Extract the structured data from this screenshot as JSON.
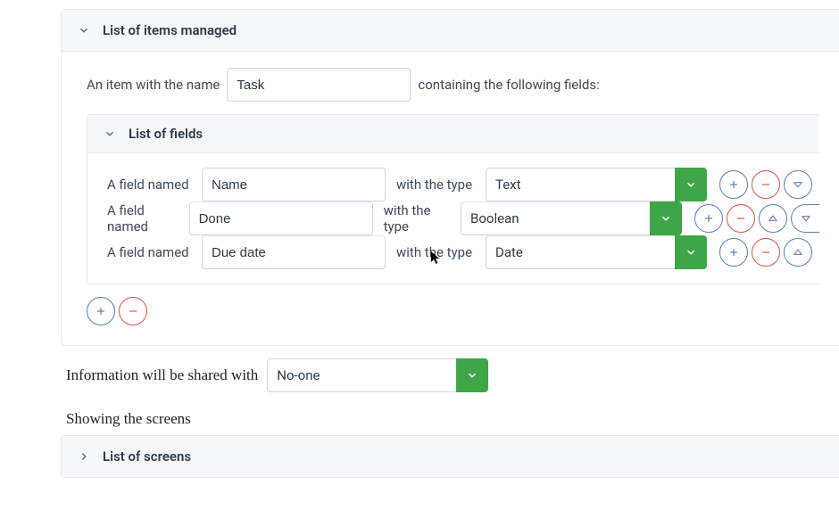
{
  "items_panel": {
    "title": "List of items managed",
    "item_prefix": "An item with the name",
    "item_name_value": "Task",
    "item_suffix": "containing the following fields:",
    "fields_panel_title": "List of fields",
    "field_prefix": "A field named",
    "field_type_prefix": "with the type",
    "fields": [
      {
        "name": "Name",
        "type": "Text"
      },
      {
        "name": "Done",
        "type": "Boolean"
      },
      {
        "name": "Due date",
        "type": "Date"
      }
    ]
  },
  "share": {
    "prefix": "Information will be shared   with",
    "value": "No-one"
  },
  "screens": {
    "heading": "Showing the screens",
    "panel_title": "List of screens"
  },
  "colors": {
    "green": "#3fa648",
    "blue": "#5b7fb0",
    "red": "#d9534f"
  }
}
